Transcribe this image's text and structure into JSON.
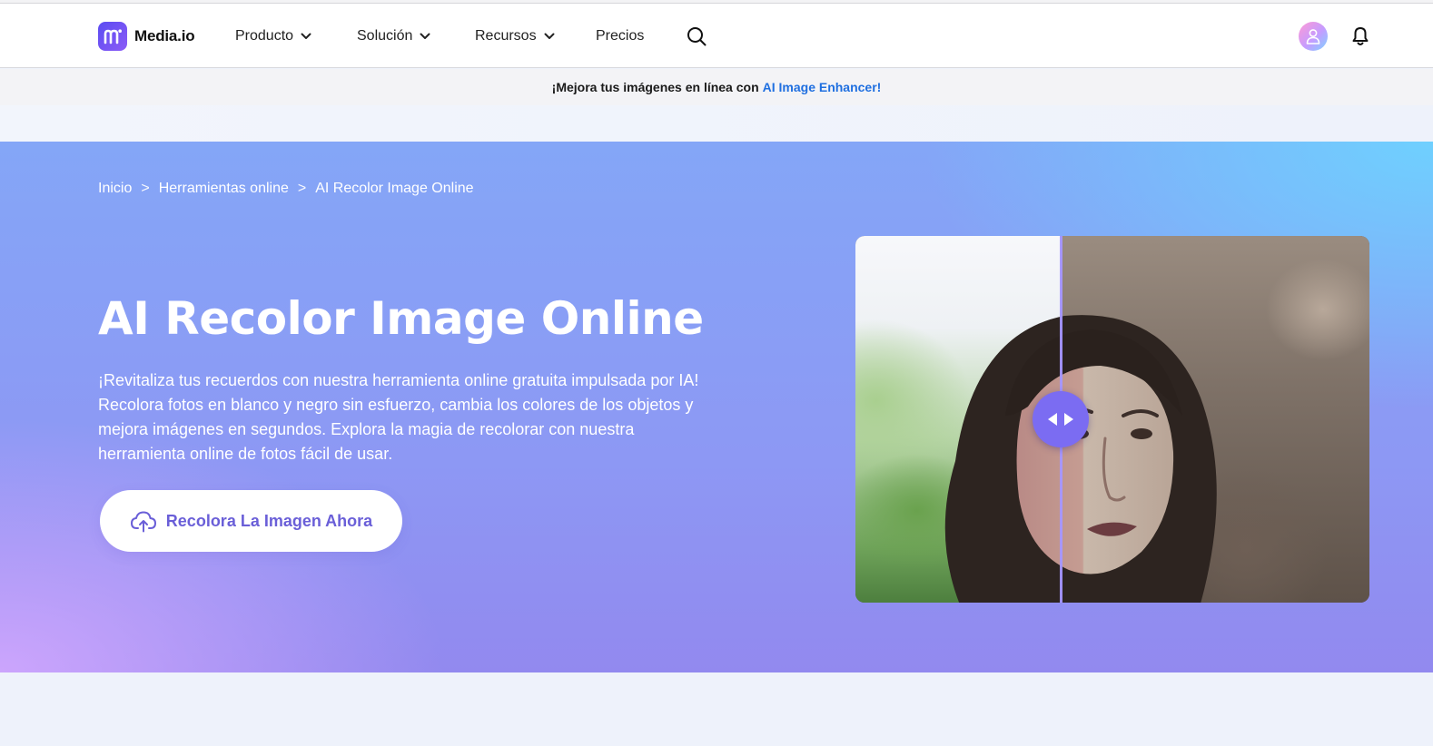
{
  "brand": {
    "name": "Media.io"
  },
  "nav": {
    "items": [
      {
        "label": "Producto",
        "has_dropdown": true
      },
      {
        "label": "Solución",
        "has_dropdown": true
      },
      {
        "label": "Recursos",
        "has_dropdown": true
      },
      {
        "label": "Precios",
        "has_dropdown": false
      }
    ],
    "icons": [
      "search-icon",
      "user-avatar-icon",
      "bell-icon"
    ]
  },
  "promo": {
    "text": "¡Mejora tus imágenes en línea con",
    "link": "AI Image Enhancer!"
  },
  "breadcrumb": [
    {
      "label": "Inicio"
    },
    {
      "label": "Herramientas online"
    },
    {
      "label": "AI Recolor Image Online"
    }
  ],
  "breadcrumb_separator": ">",
  "hero": {
    "title": "AI Recolor Image Online",
    "description": "¡Revitaliza tus recuerdos con nuestra herramienta online gratuita impulsada por IA! Recolora fotos en blanco y negro sin esfuerzo, cambia los colores de los objetos y mejora imágenes en segundos. Explora la magia de recolorar con nuestra herramienta online de fotos fácil de usar.",
    "cta_label": "Recolora La Imagen Ahora",
    "cta_icon": "cloud-upload-icon"
  },
  "compare_slider": {
    "position": 0.4,
    "handle_icon": "left-right-arrows-icon"
  },
  "colors": {
    "brand_purple": "#6a5fd8",
    "link_blue": "#1f6fe0",
    "handle": "#7b6cf2"
  }
}
